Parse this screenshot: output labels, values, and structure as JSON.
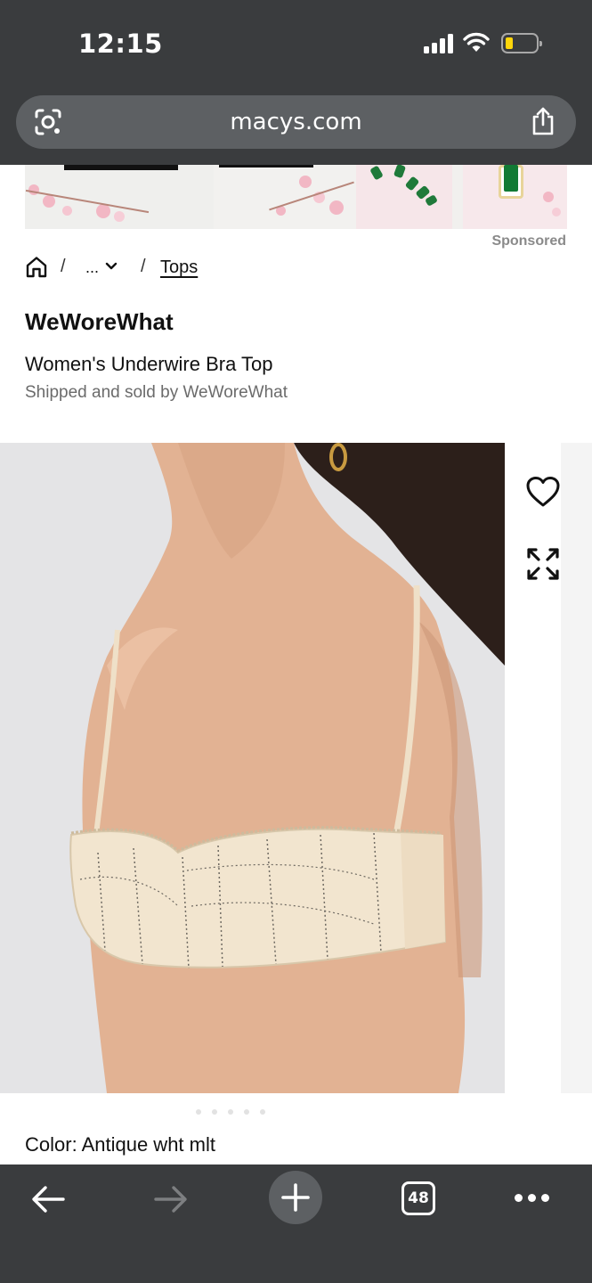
{
  "status_bar": {
    "time": "12:15"
  },
  "browser": {
    "url": "macys.com",
    "tab_count": "48"
  },
  "ad": {
    "sponsored_label": "Sponsored"
  },
  "breadcrumb": {
    "separator": "/",
    "ellipsis": "...",
    "current": "Tops"
  },
  "product": {
    "brand": "WeWoreWhat",
    "title": "Women's Underwire Bra Top",
    "seller": "Shipped and sold by WeWoreWhat",
    "color_label": "Color: Antique wht mlt"
  },
  "icons": {
    "lens": "google-lens-icon",
    "share": "share-icon",
    "home": "home-icon",
    "favorite": "heart-icon",
    "expand": "expand-icon",
    "back": "back-arrow-icon",
    "forward": "forward-arrow-icon",
    "new_tab": "plus-icon",
    "more": "more-dots-icon"
  },
  "colors": {
    "chrome_bg": "#3a3c3e",
    "url_bar_bg": "#5d6063",
    "battery_level": "#ffd60a"
  }
}
